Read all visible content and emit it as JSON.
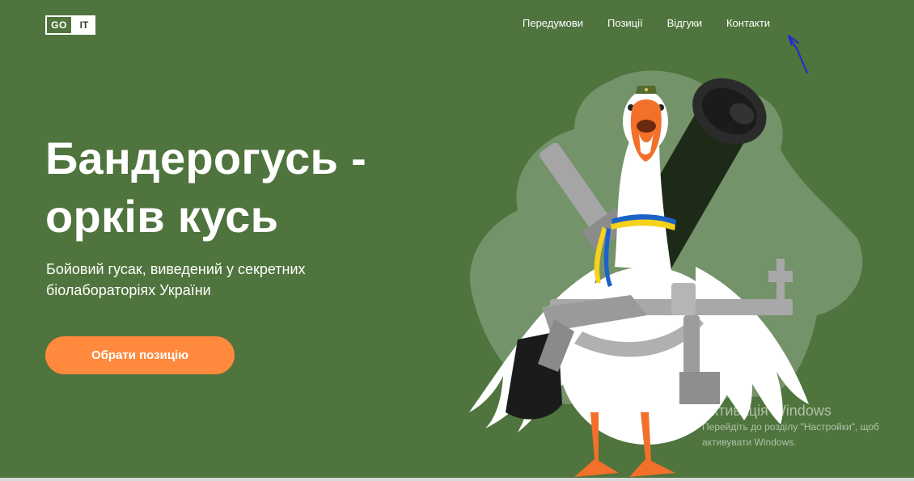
{
  "logo": {
    "left": "GO",
    "right": "IT"
  },
  "nav": {
    "items": [
      "Передумови",
      "Позиції",
      "Відгуки",
      "Контакти"
    ]
  },
  "hero": {
    "title_line1": "Бандерогусь -",
    "title_line2": "орків кусь",
    "subtitle_line1": "Бойовий гусак, виведений у секретних",
    "subtitle_line2": "біолабораторіях України",
    "cta_label": "Обрати позицію"
  },
  "watermark": {
    "title": "Активація Windows",
    "line1": "Перейдіть до розділу \"Настройки\", щоб",
    "line2": "активувати Windows."
  },
  "colors": {
    "background": "#4f743d",
    "accent": "#ff8a3d",
    "ribbon_blue": "#1c63c7",
    "ribbon_yellow": "#f5d21c"
  }
}
